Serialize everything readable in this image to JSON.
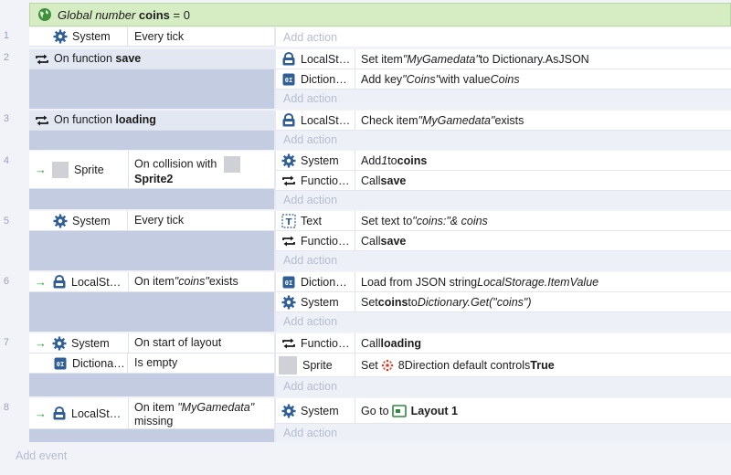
{
  "global_var": {
    "prefix": "Global number",
    "name": "coins",
    "suffix": "= 0"
  },
  "add_action": "Add action",
  "add_event": "Add event",
  "events": [
    {
      "num": "1",
      "cond_obj": "System",
      "cond_text": "Every tick"
    },
    {
      "num": "2",
      "func_prefix": "On function",
      "func_name": "save",
      "actions": [
        {
          "obj": "LocalSt…",
          "t1": "Set item ",
          "t2": "\"MyGamedata\"",
          "t3": " to Dictionary.AsJSON"
        },
        {
          "obj": "Diction…",
          "t1": "Add key ",
          "t2": "\"Coins\"",
          "t3": " with value ",
          "t4": "Coins"
        }
      ]
    },
    {
      "num": "3",
      "func_prefix": "On function",
      "func_name": "loading",
      "actions": [
        {
          "obj": "LocalSt…",
          "t1": "Check item ",
          "t2": "\"MyGamedata\"",
          "t3": " exists"
        }
      ]
    },
    {
      "num": "4",
      "cond_obj": "Sprite",
      "cond_text": "On collision with",
      "cond_target": "Sprite2",
      "actions": [
        {
          "obj": "System",
          "t1": "Add ",
          "t2": "1",
          "t3": " to ",
          "t4": "coins"
        },
        {
          "obj": "Functio…",
          "t1": "Call ",
          "t2": "save"
        }
      ]
    },
    {
      "num": "5",
      "cond_obj": "System",
      "cond_text": "Every tick",
      "actions": [
        {
          "obj": "Text",
          "t1": "Set text to ",
          "t2": "\"coins:\"& coins"
        },
        {
          "obj": "Functio…",
          "t1": "Call ",
          "t2": "save"
        }
      ]
    },
    {
      "num": "6",
      "cond_obj": "LocalSt…",
      "cond_text": "On item ",
      "cond_em": "\"coins\"",
      "cond_tail": " exists",
      "actions": [
        {
          "obj": "Diction…",
          "t1": "Load from JSON string ",
          "t2": "LocalStorage.ItemValue"
        },
        {
          "obj": "System",
          "t1": "Set ",
          "t2": "coins",
          "t3": " to ",
          "t4": "Dictionary.Get(\"coins\")"
        }
      ]
    },
    {
      "num": "7",
      "conds": [
        {
          "obj": "System",
          "text": "On start of layout"
        },
        {
          "obj": "Dictiona…",
          "text": "Is empty"
        }
      ],
      "actions": [
        {
          "obj": "Functio…",
          "t1": "Call ",
          "t2": "loading"
        },
        {
          "obj": "Sprite",
          "t1": "Set ",
          "t2": "8Direction default controls ",
          "t3": "True"
        }
      ]
    },
    {
      "num": "8",
      "cond_obj": "LocalSt…",
      "cond_text": "On item ",
      "cond_em": "\"MyGamedata\"",
      "cond_tail": "missing",
      "actions": [
        {
          "obj": "System",
          "t1": "Go to ",
          "t2": "Layout 1"
        }
      ]
    }
  ],
  "icons": {
    "system": "gear-icon",
    "function": "function-loop-icon",
    "localstorage": "localstorage-icon",
    "dictionary": "dictionary-icon",
    "text": "text-object-icon",
    "global": "globe-icon",
    "trigger": "trigger-arrow-icon",
    "layout": "layout-icon",
    "behavior": "8direction-icon"
  },
  "colors": {
    "global_bg": "#d6ecc3",
    "event_bg": "#c3cce0",
    "trigger": "#35a24c"
  }
}
